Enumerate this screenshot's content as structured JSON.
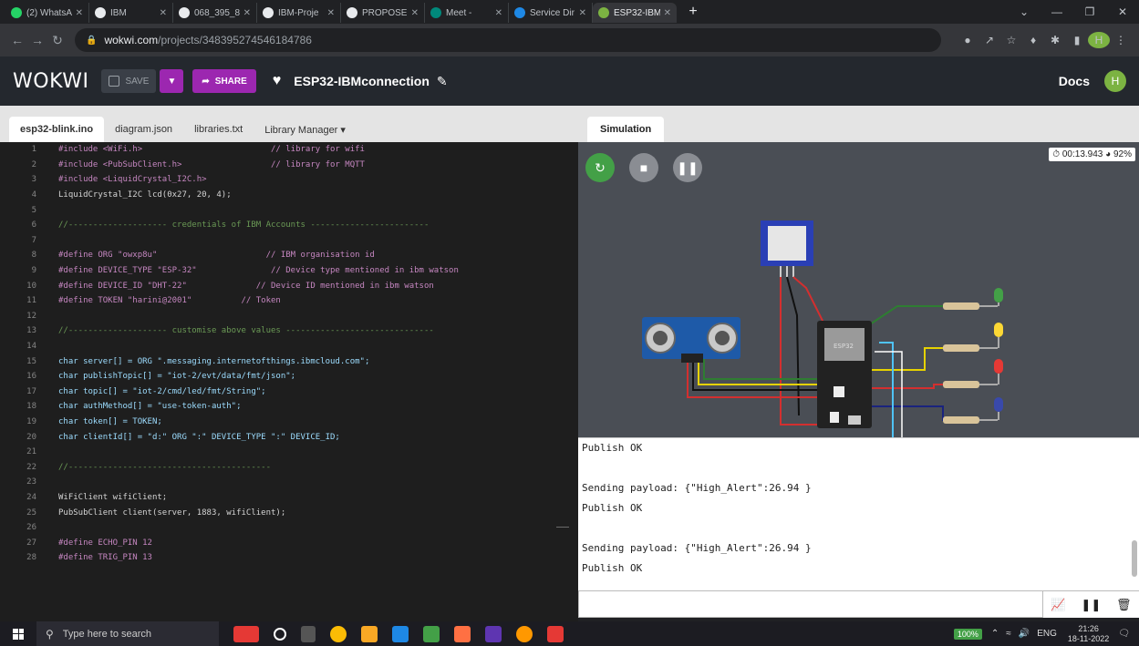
{
  "browser": {
    "tabs": [
      {
        "title": "(2) WhatsA",
        "color": "#25d366"
      },
      {
        "title": "IBM",
        "color": "#e8eaed"
      },
      {
        "title": "068_395_8",
        "color": "#e8eaed"
      },
      {
        "title": "IBM-Proje",
        "color": "#e8eaed"
      },
      {
        "title": "PROPOSED",
        "color": "#e8eaed"
      },
      {
        "title": "Meet - ",
        "color": "#00897b"
      },
      {
        "title": "Service Dir",
        "color": "#1e88e5"
      },
      {
        "title": "ESP32-IBM",
        "color": "#7cb342"
      }
    ],
    "new_tab": "+",
    "address": {
      "host": "wokwi.com",
      "path": "/projects/348395274546184786"
    }
  },
  "wokwi": {
    "logo": "WOKWI",
    "save_label": "SAVE",
    "share_label": "SHARE",
    "project_name": "ESP32-IBMconnection",
    "docs_label": "Docs",
    "user_initial": "H"
  },
  "editor": {
    "tabs": [
      "esp32-blink.ino",
      "diagram.json",
      "libraries.txt",
      "Library Manager ▾"
    ],
    "lines": [
      {
        "n": "1",
        "t": "#include <WiFi.h>                          // library for wifi"
      },
      {
        "n": "2",
        "t": "#include <PubSubClient.h>                  // library for MQTT"
      },
      {
        "n": "3",
        "t": "#include <LiquidCrystal_I2C.h>"
      },
      {
        "n": "4",
        "t": "LiquidCrystal_I2C lcd(0x27, 20, 4);"
      },
      {
        "n": "5",
        "t": ""
      },
      {
        "n": "6",
        "t": "//-------------------- credentials of IBM Accounts ------------------------"
      },
      {
        "n": "7",
        "t": ""
      },
      {
        "n": "8",
        "t": "#define ORG \"owxp8u\"                      // IBM organisation id"
      },
      {
        "n": "9",
        "t": "#define DEVICE_TYPE \"ESP-32\"               // Device type mentioned in ibm watson"
      },
      {
        "n": "10",
        "t": "#define DEVICE_ID \"DHT-22\"              // Device ID mentioned in ibm watson"
      },
      {
        "n": "11",
        "t": "#define TOKEN \"harini@2001\"          // Token"
      },
      {
        "n": "12",
        "t": ""
      },
      {
        "n": "13",
        "t": "//-------------------- customise above values ------------------------------"
      },
      {
        "n": "14",
        "t": ""
      },
      {
        "n": "15",
        "t": "char server[] = ORG \".messaging.internetofthings.ibmcloud.com\";"
      },
      {
        "n": "16",
        "t": "char publishTopic[] = \"iot-2/evt/data/fmt/json\";"
      },
      {
        "n": "17",
        "t": "char topic[] = \"iot-2/cmd/led/fmt/String\";"
      },
      {
        "n": "18",
        "t": "char authMethod[] = \"use-token-auth\";"
      },
      {
        "n": "19",
        "t": "char token[] = TOKEN;"
      },
      {
        "n": "20",
        "t": "char clientId[] = \"d:\" ORG \":\" DEVICE_TYPE \":\" DEVICE_ID;"
      },
      {
        "n": "21",
        "t": ""
      },
      {
        "n": "22",
        "t": "//-----------------------------------------"
      },
      {
        "n": "23",
        "t": ""
      },
      {
        "n": "24",
        "t": "WiFiClient wifiClient;"
      },
      {
        "n": "25",
        "t": "PubSubClient client(server, 1883, wifiClient);"
      },
      {
        "n": "26",
        "t": ""
      },
      {
        "n": "27",
        "t": "#define ECHO_PIN 12"
      },
      {
        "n": "28",
        "t": "#define TRIG_PIN 13"
      }
    ]
  },
  "simulation": {
    "tab_label": "Simulation",
    "timer": "00:13.943",
    "speed": "92%",
    "chip_label": "ESP32",
    "serial_lines": [
      "Publish OK",
      "",
      "Sending payload: {\"High_Alert\":26.94 }",
      "Publish OK",
      "",
      "Sending payload: {\"High_Alert\":26.94 }",
      "Publish OK"
    ]
  },
  "taskbar": {
    "search_placeholder": "Type here to search",
    "battery": "100%",
    "lang": "ENG",
    "time": "21:26",
    "date": "18-11-2022"
  }
}
